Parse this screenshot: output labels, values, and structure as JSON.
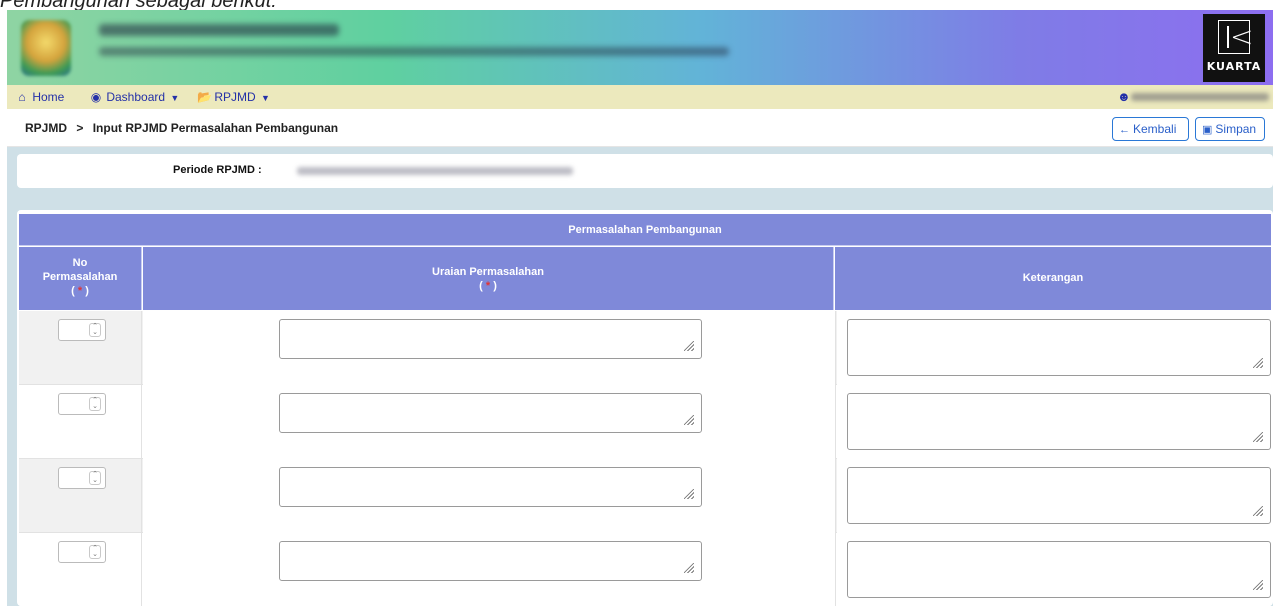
{
  "page_caption": "Pembangunan sebagai berikut:",
  "header": {
    "brand_logo_text": "KUARTA"
  },
  "navbar": {
    "home": "Home",
    "dashboard": "Dashboard",
    "rpjmd": "RPJMD"
  },
  "breadcrumb": {
    "root": "RPJMD",
    "separator": ">",
    "current": "Input RPJMD Permasalahan Pembangunan"
  },
  "actions": {
    "back_label": "Kembali",
    "save_label": "Simpan"
  },
  "periode": {
    "label": "Periode RPJMD :"
  },
  "table": {
    "title": "Permasalahan Pembangunan",
    "col_no_line1": "No",
    "col_no_line2": "Permasalahan",
    "col_uraian": "Uraian Permasalahan",
    "col_keterangan": "Keterangan",
    "required_open": "( ",
    "required_star": "*",
    "required_close": " )",
    "rows": [
      {
        "no": "",
        "uraian": "",
        "keterangan": ""
      },
      {
        "no": "",
        "uraian": "",
        "keterangan": ""
      },
      {
        "no": "",
        "uraian": "",
        "keterangan": ""
      },
      {
        "no": "",
        "uraian": "",
        "keterangan": ""
      }
    ]
  },
  "colors": {
    "table_header": "#7f89d9",
    "nav_bg": "#ece9bd",
    "nav_link": "#2431a8",
    "required": "#e23333",
    "button_border": "#2a78d6",
    "content_bg": "#cfe0e7"
  },
  "icons": {
    "home": "home-icon",
    "dashboard": "dashboard-icon",
    "rpjmd": "folder-open-icon",
    "user": "user-icon",
    "back": "arrow-left-icon",
    "save": "save-icon"
  }
}
